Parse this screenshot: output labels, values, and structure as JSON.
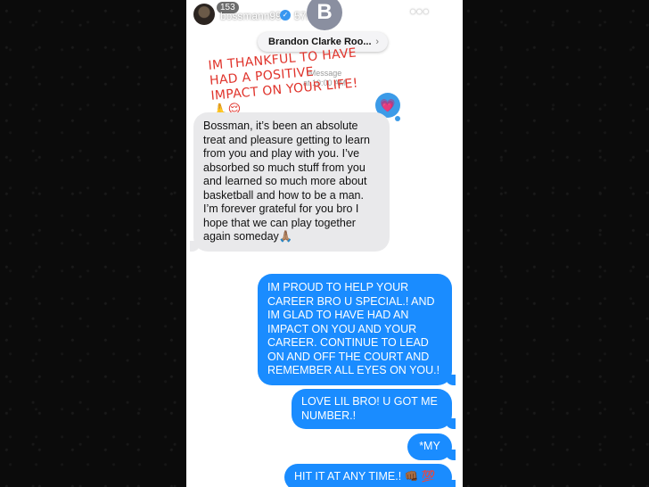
{
  "story": {
    "username": "bossmann99",
    "views": "153",
    "time_ago": "57m",
    "more_glyph": "•••",
    "close_glyph": "✕"
  },
  "contact": {
    "initial": "B",
    "name": "Brandon Clarke Roo...",
    "chevron": "›"
  },
  "thread": {
    "service": "iMessage",
    "date_partial": "at 10:00 AM"
  },
  "caption": "IM THANKFUL TO HAVE HAD A POSITIVE IMPACT ON YOUR LIFE! 🙏😌",
  "reaction": {
    "icon": "heart-icon",
    "glyph": "💗",
    "color": "#3c9be8"
  },
  "messages": [
    {
      "direction": "incoming",
      "text": "Bossman, it’s been an absolute treat and pleasure getting to learn from you and play with you. I’ve absorbed so much stuff from you and learned so much more about basketball and how to be a man.\nI’m forever grateful for you bro I hope that we can play together again someday🙏🏽"
    },
    {
      "direction": "outgoing",
      "text": "IM PROUD TO HELP YOUR CAREER BRO U SPECIAL.! AND IM GLAD TO HAVE HAD AN IMPACT ON YOU AND YOUR CAREER. CONTINUE TO LEAD ON AND OFF THE COURT AND REMEMBER ALL EYES ON YOU.!"
    },
    {
      "direction": "outgoing",
      "text": "LOVE LIL BRO! U GOT ME NUMBER.!"
    },
    {
      "direction": "outgoing",
      "text": "*MY"
    },
    {
      "direction": "outgoing",
      "text": "HIT IT AT ANY TIME.! 👊🏾 💯"
    }
  ],
  "colors": {
    "incoming_bubble": "#e9e9eb",
    "outgoing_bubble": "#1a8cff",
    "caption": "#e0342c",
    "verified": "#3897f0"
  }
}
